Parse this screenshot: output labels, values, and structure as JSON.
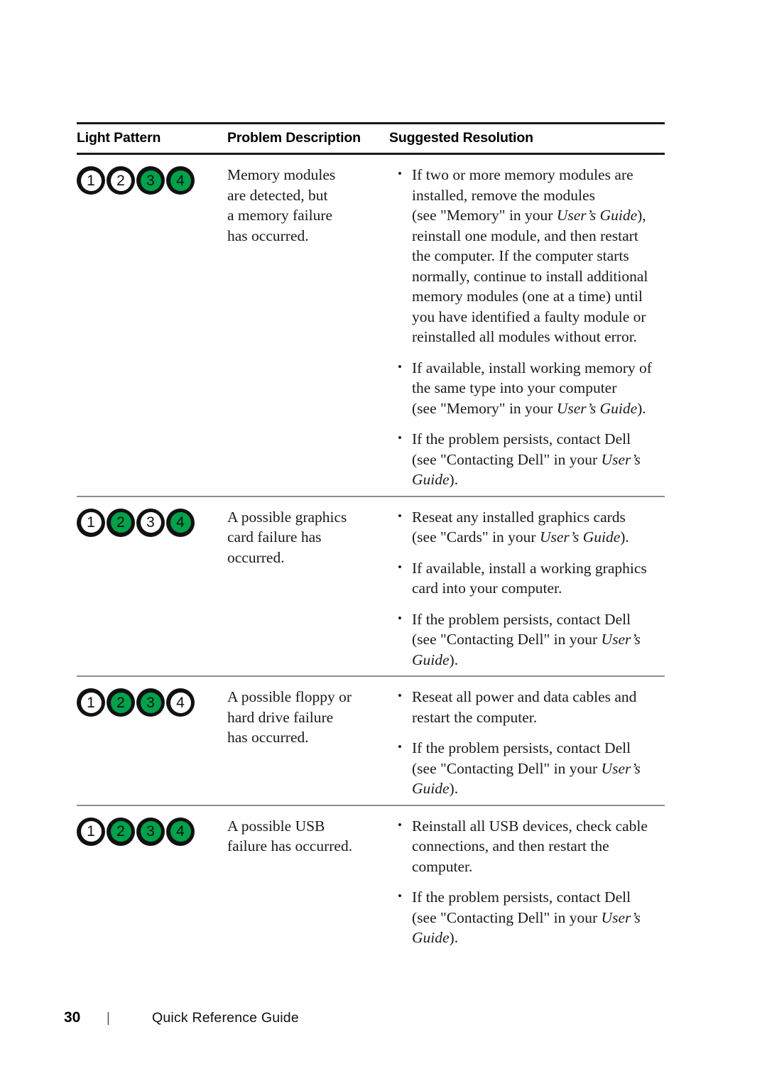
{
  "document": {
    "table_headers": {
      "light_pattern": "Light Pattern",
      "problem_description": "Problem Description",
      "suggested_resolution": "Suggested Resolution"
    },
    "colors": {
      "light_on": "#00a14b",
      "light_off": "#ffffff",
      "light_ring": "#111111",
      "rule_heavy": "#1a1a1a",
      "rule_light": "#8d8d8d"
    },
    "light_labels": [
      "1",
      "2",
      "3",
      "4"
    ],
    "rows": [
      {
        "lights": [
          false,
          false,
          true,
          true
        ],
        "problem_lines": [
          "Memory modules",
          "are detected, but",
          "a memory failure",
          "has occurred."
        ],
        "resolutions": [
          [
            {
              "text": "If two or more memory modules are"
            },
            {
              "text": "installed, remove the modules"
            },
            {
              "parts": [
                {
                  "t": "(see \"Memory\" in your "
                },
                {
                  "t": "User’s Guide",
                  "i": true
                },
                {
                  "t": "),"
                }
              ]
            },
            {
              "text": "reinstall one module, and then restart"
            },
            {
              "text": "the computer. If the computer starts"
            },
            {
              "text": "normally, continue to install additional"
            },
            {
              "text": "memory modules (one at a time) until"
            },
            {
              "text": "you have identified a faulty module or"
            },
            {
              "text": "reinstalled all modules without error."
            }
          ],
          [
            {
              "text": "If available, install working memory of"
            },
            {
              "text": "the same type into your computer"
            },
            {
              "parts": [
                {
                  "t": "(see \"Memory\" in your "
                },
                {
                  "t": "User’s Guide",
                  "i": true
                },
                {
                  "t": ")."
                }
              ]
            }
          ],
          [
            {
              "text": "If the problem persists, contact Dell"
            },
            {
              "parts": [
                {
                  "t": "(see \"Contacting Dell\" in your "
                },
                {
                  "t": "User’s",
                  "i": true
                }
              ]
            },
            {
              "parts": [
                {
                  "t": "Guide",
                  "i": true
                },
                {
                  "t": ")."
                }
              ]
            }
          ]
        ]
      },
      {
        "lights": [
          false,
          true,
          false,
          true
        ],
        "problem_lines": [
          "A possible graphics",
          "card failure has",
          "occurred."
        ],
        "resolutions": [
          [
            {
              "text": "Reseat any installed graphics cards"
            },
            {
              "parts": [
                {
                  "t": "(see \"Cards\" in your "
                },
                {
                  "t": "User’s Guide",
                  "i": true
                },
                {
                  "t": ")."
                }
              ]
            }
          ],
          [
            {
              "text": "If available, install a working graphics"
            },
            {
              "text": "card into your computer."
            }
          ],
          [
            {
              "text": "If the problem persists, contact Dell"
            },
            {
              "parts": [
                {
                  "t": "(see \"Contacting Dell\" in your "
                },
                {
                  "t": "User’s",
                  "i": true
                }
              ]
            },
            {
              "parts": [
                {
                  "t": "Guide",
                  "i": true
                },
                {
                  "t": ")."
                }
              ]
            }
          ]
        ]
      },
      {
        "lights": [
          false,
          true,
          true,
          false
        ],
        "problem_lines": [
          "A possible floppy or",
          "hard drive failure",
          "has occurred."
        ],
        "resolutions": [
          [
            {
              "text": "Reseat all power and data cables and"
            },
            {
              "text": "restart the computer."
            }
          ],
          [
            {
              "text": "If the problem persists, contact Dell"
            },
            {
              "parts": [
                {
                  "t": "(see \"Contacting Dell\" in your "
                },
                {
                  "t": "User’s",
                  "i": true
                }
              ]
            },
            {
              "parts": [
                {
                  "t": "Guide",
                  "i": true
                },
                {
                  "t": ")."
                }
              ]
            }
          ]
        ]
      },
      {
        "lights": [
          false,
          true,
          true,
          true
        ],
        "problem_lines": [
          "A possible USB",
          "failure has occurred."
        ],
        "resolutions": [
          [
            {
              "text": "Reinstall all USB devices, check cable"
            },
            {
              "text": "connections, and then restart the"
            },
            {
              "text": "computer."
            }
          ],
          [
            {
              "text": "If the problem persists, contact Dell"
            },
            {
              "parts": [
                {
                  "t": "(see \"Contacting Dell\" in your "
                },
                {
                  "t": "User’s",
                  "i": true
                }
              ]
            },
            {
              "parts": [
                {
                  "t": "Guide",
                  "i": true
                },
                {
                  "t": ")."
                }
              ]
            }
          ]
        ]
      }
    ],
    "footer": {
      "page_number": "30",
      "divider": "|",
      "title": "Quick Reference Guide"
    }
  }
}
